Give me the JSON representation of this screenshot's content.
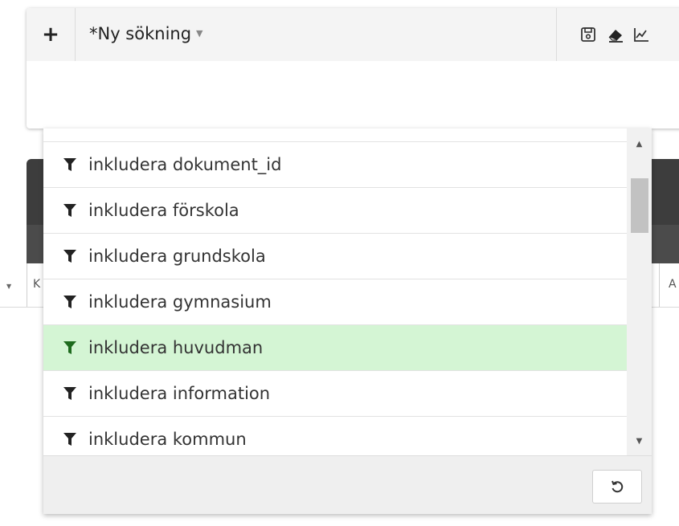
{
  "search": {
    "add_label": "+",
    "title": "*Ny sökning"
  },
  "toolbar": {
    "icons": [
      "save-icon",
      "eraser-icon",
      "chart-icon"
    ]
  },
  "background": {
    "left_header_letter": "K",
    "right_header_letter": "A"
  },
  "dropdown": {
    "items": [
      {
        "label": "inkludera dokument_id",
        "highlighted": false
      },
      {
        "label": "inkludera förskola",
        "highlighted": false
      },
      {
        "label": "inkludera grundskola",
        "highlighted": false
      },
      {
        "label": "inkludera gymnasium",
        "highlighted": false
      },
      {
        "label": "inkludera huvudman",
        "highlighted": true
      },
      {
        "label": "inkludera information",
        "highlighted": false
      },
      {
        "label": "inkludera kommun",
        "highlighted": false
      }
    ],
    "reset_icon": "undo-icon"
  },
  "colors": {
    "highlight_bg": "#d4f5d4",
    "highlight_icon": "#1e6b1e",
    "icon": "#222222"
  }
}
